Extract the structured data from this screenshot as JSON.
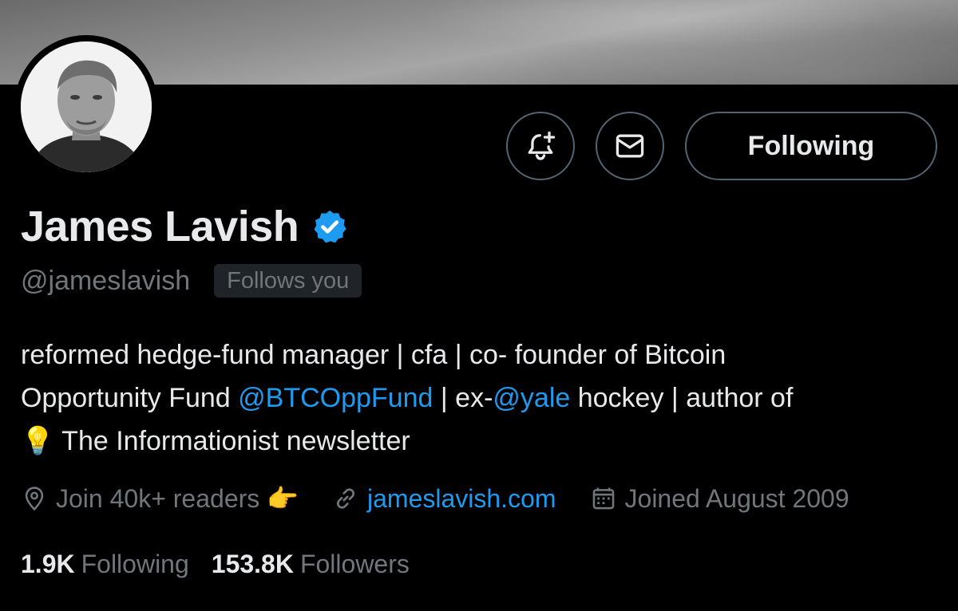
{
  "profile": {
    "display_name": "James Lavish",
    "handle": "@jameslavish",
    "follows_you": "Follows you",
    "verified_icon": "verified-badge-icon",
    "accent_color": "#1d9bf0"
  },
  "actions": {
    "notify_icon": "bell-plus-icon",
    "message_icon": "envelope-icon",
    "follow_label": "Following"
  },
  "bio": {
    "line1": "reformed hedge-fund manager | cfa | co- founder of Bitcoin",
    "line2_prefix": "Opportunity Fund ",
    "mention1": "@BTCOppFund",
    "line2_middle": " | ex-",
    "mention2": "@yale",
    "line2_suffix": " hockey | author of",
    "line3_emoji": "💡",
    "line3_text": " The Informationist newsletter"
  },
  "meta": {
    "location": "Join 40k+ readers 👉",
    "location_icon": "location-pin-icon",
    "website": "jameslavish.com",
    "website_icon": "link-icon",
    "joined": "Joined August 2009",
    "joined_icon": "calendar-icon"
  },
  "stats": {
    "following_count": "1.9K",
    "following_label": "Following",
    "followers_count": "153.8K",
    "followers_label": "Followers"
  }
}
